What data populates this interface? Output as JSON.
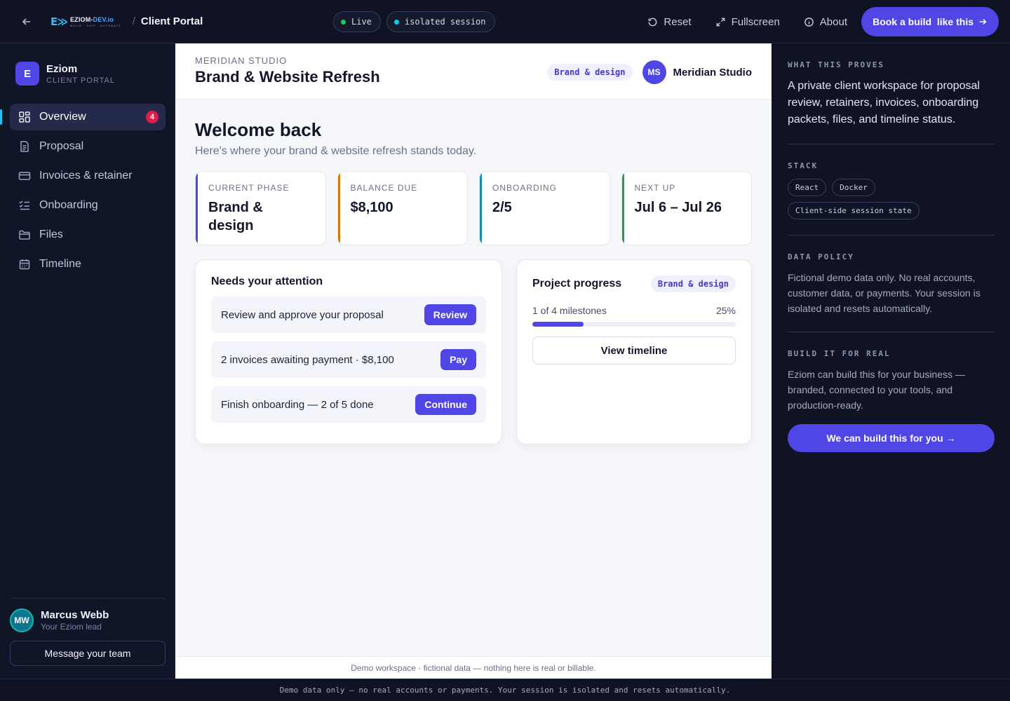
{
  "topbar": {
    "logo_mark": "E≫",
    "logo_word_main": "EZIOM-",
    "logo_word_accent": "DEV.io",
    "logo_tagline": "BUILD · SHIP · AUTOMATE",
    "separator": "/",
    "page_title": "Client Portal",
    "pills": [
      {
        "label": "Live",
        "dot_color": "#22c55e"
      },
      {
        "label": "isolated session",
        "dot_color": "#22c3ee"
      }
    ],
    "nav": [
      {
        "label": "Reset",
        "icon": "reset-icon"
      },
      {
        "label": "Fullscreen",
        "icon": "expand-icon"
      },
      {
        "label": "About",
        "icon": "info-icon"
      }
    ],
    "cta_label": "Book a build  like this"
  },
  "sidebar": {
    "brand_initial": "E",
    "brand_name": "Eziom",
    "brand_sub": "CLIENT PORTAL",
    "items": [
      {
        "label": "Overview",
        "icon": "grid-icon",
        "badge": "4",
        "active": true
      },
      {
        "label": "Proposal",
        "icon": "document-icon"
      },
      {
        "label": "Invoices & retainer",
        "icon": "card-icon"
      },
      {
        "label": "Onboarding",
        "icon": "checklist-icon"
      },
      {
        "label": "Files",
        "icon": "folder-icon"
      },
      {
        "label": "Timeline",
        "icon": "calendar-icon"
      }
    ],
    "lead": {
      "initials": "MW",
      "name": "Marcus Webb",
      "role": "Your Eziom lead",
      "message_button": "Message your team"
    }
  },
  "main": {
    "client_label": "MERIDIAN STUDIO",
    "project_title": "Brand & Website Refresh",
    "phase_tag": "Brand & design",
    "client_initials": "MS",
    "client_name": "Meridian Studio",
    "welcome": "Welcome back",
    "welcome_sub": "Here's where your brand & website refresh stands today.",
    "stats": [
      {
        "label": "CURRENT PHASE",
        "value": "Brand & design",
        "accent": "#4f46e5"
      },
      {
        "label": "BALANCE DUE",
        "value": "$8,100",
        "accent": "#d97706"
      },
      {
        "label": "ONBOARDING",
        "value": "2/5",
        "accent": "#0891b2"
      },
      {
        "label": "NEXT UP",
        "value": "Jul 6 – Jul 26",
        "accent": "#16a34a"
      }
    ],
    "attention": {
      "title": "Needs your attention",
      "tasks": [
        {
          "text": "Review and approve your proposal",
          "action": "Review"
        },
        {
          "text": "2 invoices awaiting payment · $8,100",
          "action": "Pay"
        },
        {
          "text": "Finish onboarding — 2 of 5 done",
          "action": "Continue"
        }
      ]
    },
    "progress": {
      "title": "Project progress",
      "tag": "Brand & design",
      "milestones_text": "1 of 4 milestones",
      "percent_text": "25%",
      "percent": 25,
      "button": "View timeline"
    },
    "footer": "Demo workspace · fictional data — nothing here is real or billable."
  },
  "rightpanel": {
    "proves_label": "WHAT THIS PROVES",
    "proves_text": "A private client workspace for proposal review, retainers, invoices, onboarding packets, files, and timeline status.",
    "stack_label": "STACK",
    "stack": [
      "React",
      "Docker",
      "Client-side session state"
    ],
    "policy_label": "DATA POLICY",
    "policy_text": "Fictional demo data only. No real accounts, customer data, or payments. Your session is isolated and resets automatically.",
    "build_label": "BUILD IT FOR REAL",
    "build_text": "Eziom can build this for your business — branded, connected to your tools, and production-ready.",
    "build_cta": "We can build this for you →"
  },
  "bottombar": "Demo data only — no real accounts or payments. Your session is isolated and resets automatically."
}
